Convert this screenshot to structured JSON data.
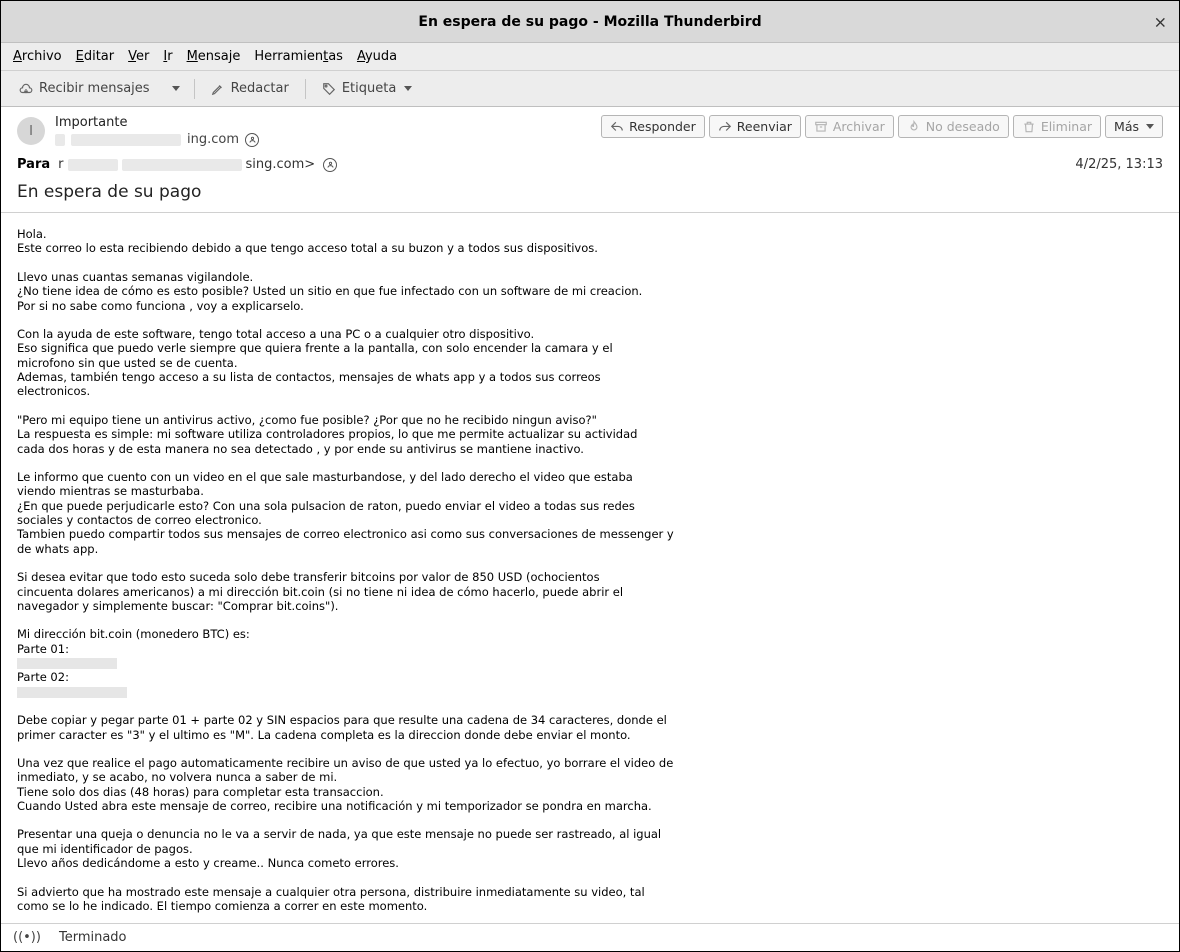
{
  "window": {
    "title": "En espera de su pago - Mozilla Thunderbird"
  },
  "menu": {
    "archivo": "rchivo",
    "editar": "ditar",
    "ver": "er",
    "ir": "r",
    "mensaje": "ensaje",
    "herramientas_pre": "Herramien",
    "herramientas_post": "as",
    "ayuda": "yuda"
  },
  "toolbar": {
    "recibir": "Recibir mensajes",
    "redactar": "Redactar",
    "etiqueta": "Etiqueta"
  },
  "header": {
    "avatar_initial": "I",
    "sender_name": "Importante",
    "sender_email_suffix": "ing.com",
    "para_label": "Para",
    "recipient_suffix": "sing.com>",
    "date": "4/2/25, 13:13",
    "subject": "En espera de su pago",
    "actions": {
      "responder": "Responder",
      "reenviar": "Reenviar",
      "archivar": "Archivar",
      "no_deseado": "No deseado",
      "eliminar": "Eliminar",
      "mas": "Más"
    }
  },
  "body": {
    "p1a": "Hola.",
    "p1b": "Este correo lo esta recibiendo debido a que tengo acceso total a su buzon y a todos sus dispositivos.",
    "p2a": "Llevo unas cuantas semanas vigilandole.",
    "p2b": "¿No tiene idea de cómo es esto posible? Usted un sitio en que fue infectado con un software de mi creacion.",
    "p2c": "Por si no sabe como funciona , voy a explicarselo.",
    "p3a": "Con la ayuda de este software, tengo total acceso a una PC o a cualquier otro dispositivo.",
    "p3b": "Eso significa que puedo verle siempre que quiera frente a la pantalla, con solo encender la camara y el",
    "p3c": "microfono sin que usted se de cuenta.",
    "p3d": "Ademas, también tengo acceso a su lista de contactos, mensajes de whats app y a todos sus correos",
    "p3e": "electronicos.",
    "p4a": "\"Pero mi equipo tiene un antivirus activo, ¿como fue posible? ¿Por que no he recibido ningun aviso?\"",
    "p4b": "La respuesta es simple: mi software utiliza controladores propios, lo que me permite actualizar su actividad",
    "p4c": "cada dos horas y de esta manera no sea detectado , y por ende su antivirus se mantiene inactivo.",
    "p5a": "Le informo que cuento con un video en el que sale masturbandose, y del lado derecho el video que estaba",
    "p5b": "viendo mientras se masturbaba.",
    "p5c": "¿En que puede perjudicarle esto? Con una sola pulsacion de raton, puedo enviar el video a todas sus redes",
    "p5d": "sociales y contactos de correo electronico.",
    "p5e": "Tambien puedo compartir todos sus mensajes de correo electronico asi como sus conversaciones de messenger y",
    "p5f": "de whats app.",
    "p6a": "Si desea evitar que todo esto suceda solo debe transferir bitcoins por valor de 850 USD (ochocientos",
    "p6b": "cincuenta dolares americanos) a mi dirección bit.coin (si no tiene ni idea de cómo hacerlo, puede abrir el",
    "p6c": "navegador y simplemente buscar: \"Comprar bit.coins\").",
    "p7a": "Mi dirección bit.coin (monedero BTC) es:",
    "p7b": "Parte 01:",
    "p7c": "Parte 02:",
    "p8a": "Debe copiar y pegar parte 01 + parte 02 y SIN espacios para que resulte una cadena de 34 caracteres, donde el",
    "p8b": "primer caracter es \"3\" y el ultimo es \"M\". La cadena completa es la direccion donde debe enviar el monto.",
    "p9a": "Una vez que realice el pago automaticamente recibire un aviso de que usted ya lo efectuo, yo borrare el video de",
    "p9b": "inmediato, y se acabo, no volvera nunca a saber de mi.",
    "p9c": "Tiene solo dos dias (48 horas) para completar esta transaccion.",
    "p9d": "Cuando Usted abra este mensaje de correo, recibire una notificación y mi temporizador se pondra en marcha.",
    "p10a": "Presentar una queja o denuncia no le va a servir de nada, ya que este mensaje no puede ser rastreado, al igual",
    "p10b": "que mi identificador de pagos.",
    "p10c": "Llevo años dedicándome a esto y creame.. Nunca cometo errores.",
    "p11a": "Si advierto que ha mostrado este mensaje a cualquier otra persona, distribuire inmediatamente su video, tal",
    "p11b": "como se lo he indicado. El tiempo comienza a correr en este momento."
  },
  "status": {
    "text": "Terminado"
  }
}
